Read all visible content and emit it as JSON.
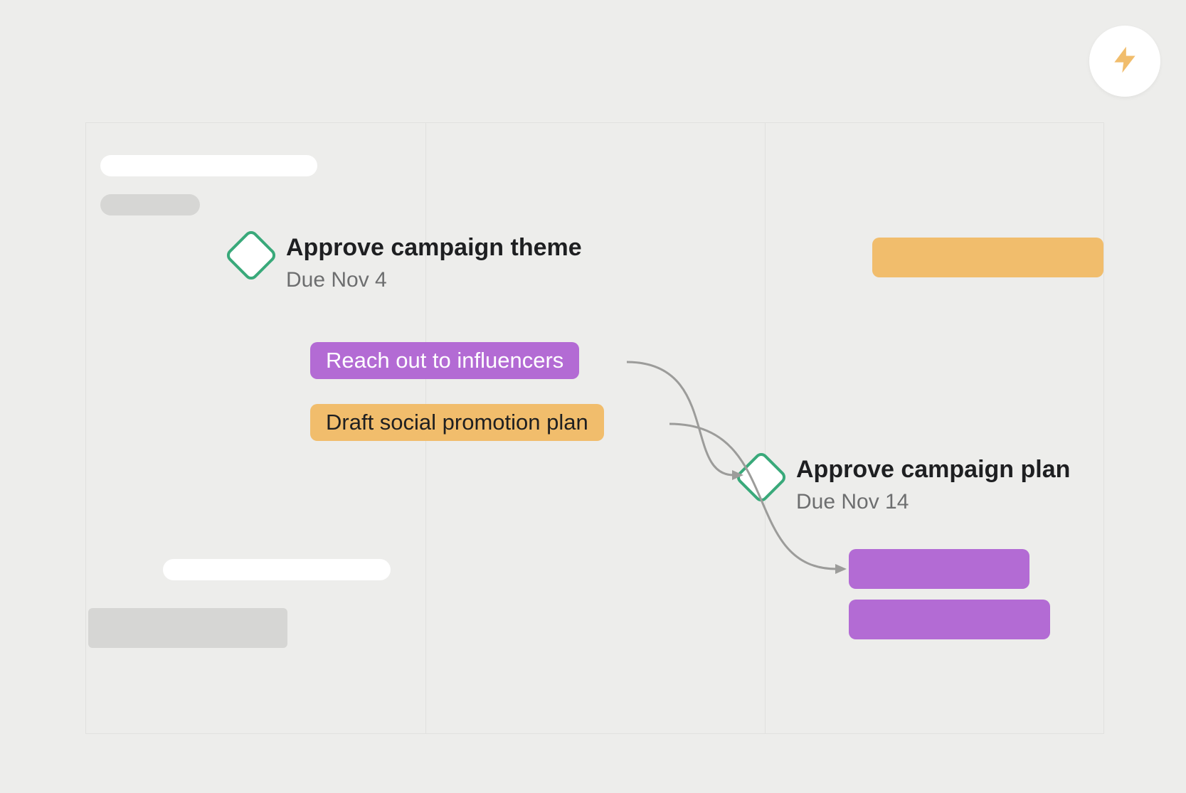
{
  "colors": {
    "purple": "#b36bd4",
    "orange": "#f1bd6c",
    "green": "#39a97a",
    "text": "#1e1f21",
    "muted": "#6d6e6f"
  },
  "fab": {
    "icon": "bolt-icon"
  },
  "milestones": {
    "m1": {
      "title": "Approve campaign theme",
      "due": "Due Nov 4"
    },
    "m2": {
      "title": "Approve campaign plan",
      "due": "Due Nov 14"
    }
  },
  "tasks": {
    "t1": {
      "label": "Reach out to influencers"
    },
    "t2": {
      "label": "Draft social promotion plan"
    }
  }
}
